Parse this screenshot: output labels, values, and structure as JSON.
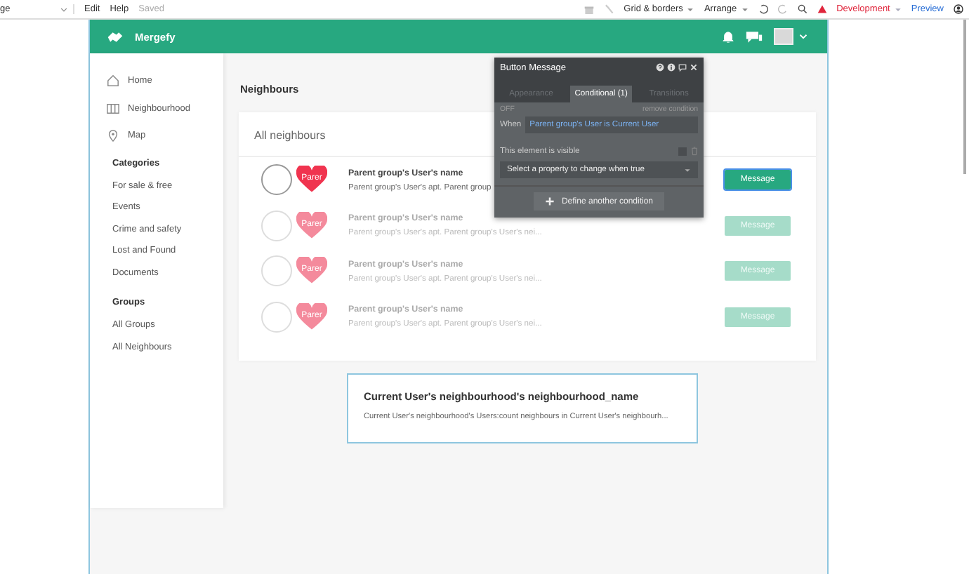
{
  "toolbar": {
    "page_selector": "ge",
    "menu": [
      "Edit",
      "Help"
    ],
    "save_status": "Saved",
    "grid": "Grid & borders",
    "arrange": "Arrange",
    "environment": "Development",
    "preview": "Preview"
  },
  "header": {
    "brand": "Mergefy"
  },
  "sidebar": {
    "nav": [
      {
        "label": "Home",
        "kind": "home"
      },
      {
        "label": "Neighbourhood",
        "kind": "map-book"
      },
      {
        "label": "Map",
        "kind": "pin"
      }
    ],
    "sections": [
      {
        "title": "Categories",
        "items": [
          "For sale & free",
          "Events",
          "Crime and safety",
          "Lost and Found",
          "Documents"
        ]
      },
      {
        "title": "Groups",
        "items": [
          "All Groups",
          "All Neighbours"
        ]
      }
    ]
  },
  "page_title": "Neighbours",
  "card": {
    "title": "All neighbours",
    "rows": [
      {
        "badge": "Parer",
        "name": "Parent group's User's name",
        "detail": "Parent group's User's apt. Parent group",
        "button": "Message",
        "faded": false,
        "selected": true
      },
      {
        "badge": "Parer",
        "name": "Parent group's User's name",
        "detail": "Parent group's User's apt. Parent group's User's nei...",
        "button": "Message",
        "faded": true,
        "selected": false
      },
      {
        "badge": "Parer",
        "name": "Parent group's User's name",
        "detail": "Parent group's User's apt. Parent group's User's nei...",
        "button": "Message",
        "faded": true,
        "selected": false
      },
      {
        "badge": "Parer",
        "name": "Parent group's User's name",
        "detail": "Parent group's User's apt. Parent group's User's nei...",
        "button": "Message",
        "faded": true,
        "selected": false
      }
    ]
  },
  "info_card": {
    "title": "Current User's neighbourhood's neighbourhood_name",
    "text": "Current User's neighbourhood's Users:count neighbours in Current User's neighbourh..."
  },
  "panel": {
    "title": "Button Message",
    "tabs": [
      {
        "label": "Appearance",
        "selected": false
      },
      {
        "label": "Conditional (1)",
        "selected": true
      },
      {
        "label": "Transitions",
        "selected": false
      }
    ],
    "state": "OFF",
    "remove": "remove condition",
    "when_label": "When",
    "condition": "Parent group's User is Current User",
    "visible_label": "This element is visible",
    "visible_checked": false,
    "property_placeholder": "Select a property to change when true",
    "add_button": "Define another condition"
  }
}
